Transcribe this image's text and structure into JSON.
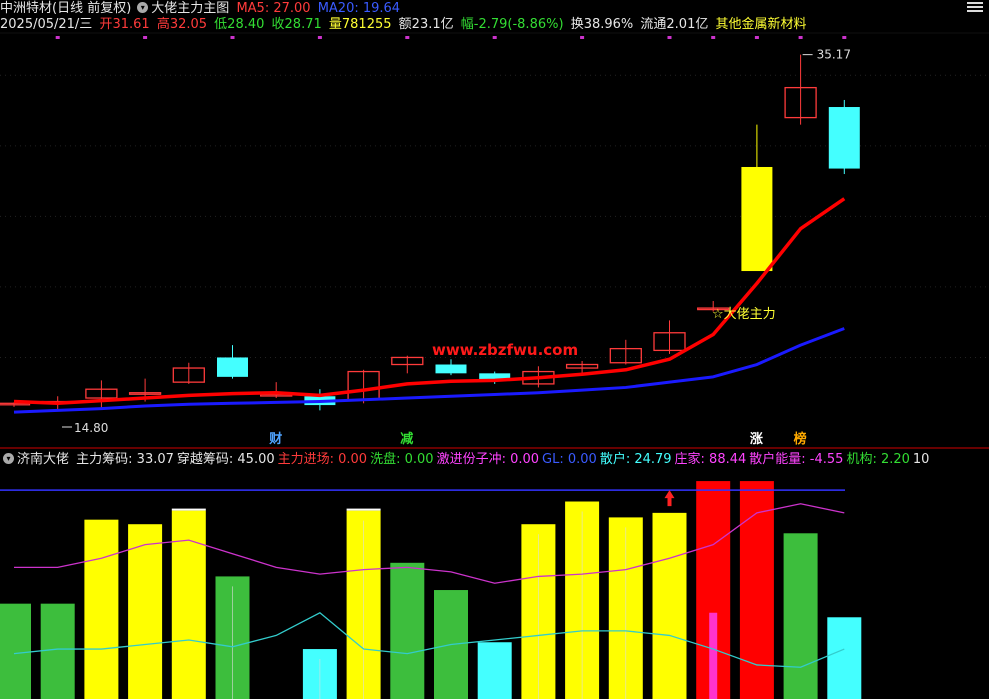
{
  "header": {
    "stock": "中洲特材(日线 前复权)",
    "template": "大佬主力主图",
    "ma5_label": "MA5: 27.00",
    "ma20_label": "MA20: 19.64",
    "date": "2025/05/21/三",
    "open": "开31.61",
    "high": "高32.05",
    "low": "低28.40",
    "close": "收28.71",
    "volume": "量781255",
    "amount": "额23.1亿",
    "change": "幅-2.79(-8.86%)",
    "turnover": "换38.96%",
    "float": "流通2.01亿",
    "sector": "其他金属新材料"
  },
  "annotations": {
    "high_price": "35.17",
    "low_price": "14.80",
    "signal": "☆大佬主力",
    "watermark": "www.zbzfwu.com",
    "markers": [
      {
        "text": "财",
        "color": "#4fa3ff"
      },
      {
        "text": "减",
        "color": "#33dd33"
      },
      {
        "text": "涨",
        "color": "#ffffff"
      },
      {
        "text": "榜",
        "color": "#ffaa00"
      }
    ]
  },
  "indicator": {
    "name": "济南大佬",
    "items": [
      {
        "text": "主力筹码: 33.07",
        "color": "#e6e6e6"
      },
      {
        "text": "穿越筹码: 45.00",
        "color": "#e6e6e6"
      },
      {
        "text": "主力进场: 0.00",
        "color": "#ff3b3b"
      },
      {
        "text": "洗盘: 0.00",
        "color": "#33dd33"
      },
      {
        "text": "激进份子冲: 0.00",
        "color": "#ff44ff"
      },
      {
        "text": "GL: 0.00",
        "color": "#3a5bff"
      },
      {
        "text": "散户: 24.79",
        "color": "#44ffff"
      },
      {
        "text": "庄家: 88.44",
        "color": "#ff44ff"
      },
      {
        "text": "散户能量: -4.55",
        "color": "#ff44ff"
      },
      {
        "text": "机构: 2.20",
        "color": "#33dd33"
      },
      {
        "text": "10",
        "color": "#e6e6e6"
      }
    ]
  },
  "colors": {
    "up": "#ff3b3b",
    "down": "#44ffff",
    "ma5": "#ff0000",
    "ma20": "#1a1aff",
    "limitup": "#ffff00"
  },
  "chart_data": [
    {
      "type": "candlestick",
      "title": "大佬主力主图",
      "ylim": [
        14,
        36
      ],
      "candles": [
        {
          "o": 15.35,
          "h": 15.45,
          "l": 15.2,
          "c": 15.4
        },
        {
          "o": 15.5,
          "h": 15.8,
          "l": 15.0,
          "c": 15.5
        },
        {
          "o": 15.7,
          "h": 16.7,
          "l": 15.1,
          "c": 16.2
        },
        {
          "o": 16.0,
          "h": 16.8,
          "l": 15.5,
          "c": 16.0
        },
        {
          "o": 16.6,
          "h": 17.7,
          "l": 16.5,
          "c": 17.4
        },
        {
          "o": 18.0,
          "h": 18.7,
          "l": 16.8,
          "c": 16.9
        },
        {
          "o": 15.9,
          "h": 16.6,
          "l": 15.7,
          "c": 15.9
        },
        {
          "o": 15.8,
          "h": 16.2,
          "l": 15.0,
          "c": 15.3
        },
        {
          "o": 15.6,
          "h": 17.3,
          "l": 15.4,
          "c": 17.2
        },
        {
          "o": 17.6,
          "h": 18.1,
          "l": 17.1,
          "c": 18.0
        },
        {
          "o": 17.6,
          "h": 17.9,
          "l": 17.0,
          "c": 17.1
        },
        {
          "o": 17.1,
          "h": 17.2,
          "l": 16.5,
          "c": 16.7
        },
        {
          "o": 16.5,
          "h": 17.5,
          "l": 16.3,
          "c": 17.2
        },
        {
          "o": 17.4,
          "h": 17.8,
          "l": 17.1,
          "c": 17.6
        },
        {
          "o": 17.7,
          "h": 19.0,
          "l": 17.6,
          "c": 18.5
        },
        {
          "o": 18.4,
          "h": 20.1,
          "l": 18.2,
          "c": 19.4
        },
        {
          "o": 20.8,
          "h": 21.2,
          "l": 20.6,
          "c": 20.8
        },
        {
          "o": 22.9,
          "h": 31.2,
          "l": 22.9,
          "c": 28.8
        },
        {
          "o": 31.6,
          "h": 35.17,
          "l": 31.2,
          "c": 33.3
        },
        {
          "o": 32.2,
          "h": 32.6,
          "l": 28.4,
          "c": 28.71
        }
      ],
      "ma5": [
        15.5,
        15.4,
        15.55,
        15.7,
        15.85,
        15.95,
        16.0,
        15.85,
        16.15,
        16.5,
        16.65,
        16.7,
        16.85,
        17.05,
        17.3,
        17.9,
        19.3,
        22.2,
        25.3,
        27.0
      ],
      "ma20": [
        14.9,
        15.0,
        15.1,
        15.25,
        15.35,
        15.4,
        15.45,
        15.5,
        15.6,
        15.7,
        15.8,
        15.9,
        16.0,
        16.15,
        16.3,
        16.6,
        16.9,
        17.6,
        18.7,
        19.64
      ]
    },
    {
      "type": "bar",
      "title": "济南大佬",
      "ylim": [
        0,
        100
      ],
      "values": [
        42,
        42,
        79,
        77,
        83,
        54,
        6,
        22,
        83,
        60,
        48,
        25,
        77,
        87,
        80,
        82,
        96,
        96,
        73,
        36
      ],
      "bar_colors": [
        "#3dbe3d",
        "#3dbe3d",
        "#ffff00",
        "#ffff00",
        "#ffff00",
        "#3dbe3d",
        "#000000",
        "#44ffff",
        "#ffff00",
        "#3dbe3d",
        "#3dbe3d",
        "#44ffff",
        "#ffff00",
        "#ffff00",
        "#ffff00",
        "#ffff00",
        "#ff0000",
        "#ff0000",
        "#3dbe3d",
        "#44ffff"
      ],
      "magenta_line": [
        58,
        58,
        62,
        68,
        70,
        64,
        58,
        55,
        57,
        58,
        56,
        51,
        54,
        55,
        57,
        62,
        68,
        82,
        86,
        82
      ],
      "cyan_line": [
        20,
        22,
        22,
        24,
        26,
        23,
        28,
        38,
        22,
        20,
        24,
        26,
        28,
        30,
        30,
        28,
        22,
        15,
        14,
        22
      ],
      "reference_line": 92
    }
  ]
}
